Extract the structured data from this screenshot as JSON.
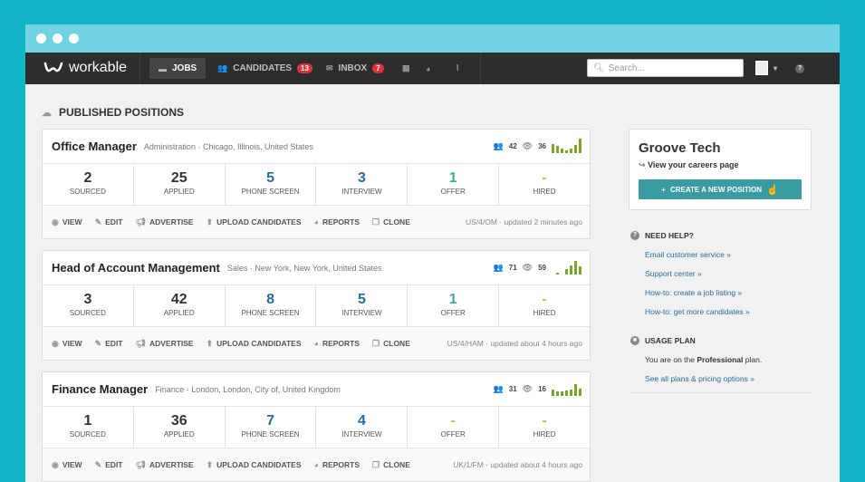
{
  "nav": {
    "logo_text": "workable",
    "jobs": "JOBS",
    "candidates": "CANDIDATES",
    "candidates_count": "13",
    "inbox": "INBOX",
    "inbox_count": "7",
    "search_placeholder": "Search..."
  },
  "section_title": "PUBLISHED POSITIONS",
  "positions": [
    {
      "title": "Office Manager",
      "meta": "Administration · Chicago, Illinois, United States",
      "people": "42",
      "views": "36",
      "stages": [
        {
          "num": "2",
          "label": "SOURCED"
        },
        {
          "num": "25",
          "label": "APPLIED"
        },
        {
          "num": "5",
          "label": "PHONE SCREEN"
        },
        {
          "num": "3",
          "label": "INTERVIEW"
        },
        {
          "num": "1",
          "label": "OFFER"
        },
        {
          "num": "-",
          "label": "HIRED"
        }
      ],
      "updated": "US/4/OM · updated 2 minutes ago"
    },
    {
      "title": "Head of Account Management",
      "meta": "Sales · New York, New York, United States",
      "people": "71",
      "views": "59",
      "stages": [
        {
          "num": "3",
          "label": "SOURCED"
        },
        {
          "num": "42",
          "label": "APPLIED"
        },
        {
          "num": "8",
          "label": "PHONE SCREEN"
        },
        {
          "num": "5",
          "label": "INTERVIEW"
        },
        {
          "num": "1",
          "label": "OFFER"
        },
        {
          "num": "-",
          "label": "HIRED"
        }
      ],
      "updated": "US/4/HAM · updated about 4 hours ago"
    },
    {
      "title": "Finance Manager",
      "meta": "Finance · London, London, City of, United Kingdom",
      "people": "31",
      "views": "16",
      "stages": [
        {
          "num": "1",
          "label": "SOURCED"
        },
        {
          "num": "36",
          "label": "APPLIED"
        },
        {
          "num": "7",
          "label": "PHONE SCREEN"
        },
        {
          "num": "4",
          "label": "INTERVIEW"
        },
        {
          "num": "-",
          "label": "OFFER"
        },
        {
          "num": "-",
          "label": "HIRED"
        }
      ],
      "updated": "UK/1/FM · updated about 4 hours ago"
    }
  ],
  "actions": {
    "view": "VIEW",
    "edit": "EDIT",
    "advertise": "ADVERTISE",
    "upload": "UPLOAD CANDIDATES",
    "reports": "REPORTS",
    "clone": "CLONE"
  },
  "sidebar": {
    "company": "Groove Tech",
    "careers": "View your careers page",
    "create": "CREATE A NEW POSITION",
    "help_title": "NEED HELP?",
    "help_links": [
      "Email customer service »",
      "Support center »",
      "How-to: create a job listing »",
      "How-to: get more candidates »"
    ],
    "plan_title": "USAGE PLAN",
    "plan_prefix": "You are on the ",
    "plan_name": "Professional",
    "plan_suffix": " plan.",
    "plan_link": "See all plans & pricing options »"
  },
  "colors": {
    "background": "#12b5c7",
    "accent": "#3a9ca0",
    "badge": "#d9363e",
    "sparkline": "#7aa62c"
  }
}
